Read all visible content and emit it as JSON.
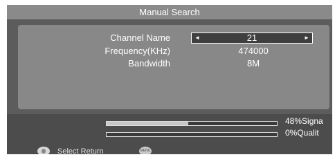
{
  "window": {
    "title": "Manual Search"
  },
  "fields": {
    "channel_name": {
      "label": "Channel Name",
      "value": "21"
    },
    "frequency": {
      "label": "Frequency(KHz)",
      "value": "474000"
    },
    "bandwidth": {
      "label": "Bandwidth",
      "value": "8M"
    }
  },
  "meters": {
    "signal": {
      "text": "48%Signa",
      "percent": 48
    },
    "quality": {
      "text": "0%Qualit",
      "percent": 0
    }
  },
  "footer": {
    "select_return": "Select Return",
    "menu_icon_text": "MENU"
  },
  "icons": {
    "left_arrow": "◄",
    "right_arrow": "►",
    "select_icon": "ok-round-icon",
    "menu_icon": "menu-round-icon"
  },
  "colors": {
    "screen_bg": "#5c5c5c",
    "title_bg": "#8a8a8a",
    "panel_bg": "#888888",
    "bottom_bg": "#4c4c4c",
    "bar_fill": "#c8c8c8"
  }
}
